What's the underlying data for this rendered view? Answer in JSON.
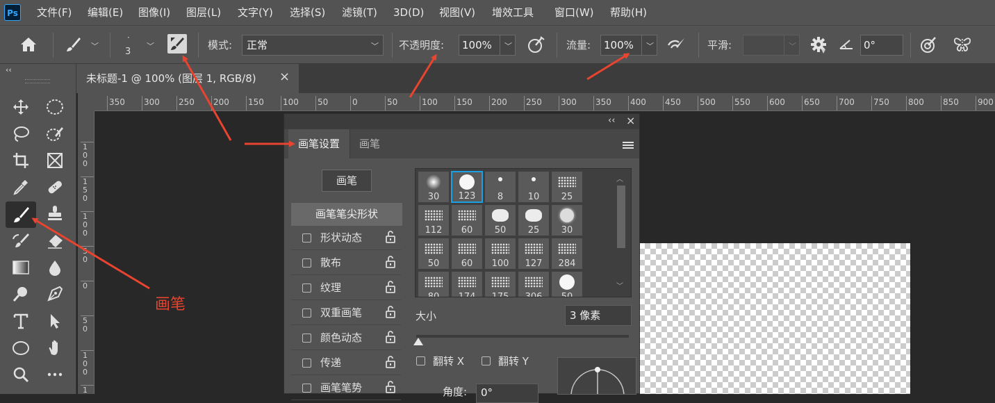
{
  "menubar": {
    "logo": "Ps",
    "items": [
      "文件(F)",
      "编辑(E)",
      "图像(I)",
      "图层(L)",
      "文字(Y)",
      "选择(S)",
      "滤镜(T)",
      "3D(D)",
      "视图(V)",
      "增效工具",
      "窗口(W)",
      "帮助(H)"
    ]
  },
  "options": {
    "brush_size": "3",
    "mode_label": "模式:",
    "mode_value": "正常",
    "opacity_label": "不透明度:",
    "opacity_value": "100%",
    "flow_label": "流量:",
    "flow_value": "100%",
    "smoothing_label": "平滑:",
    "smoothing_value": "",
    "angle_value": "0°"
  },
  "document": {
    "collapse": "‹‹",
    "tab_title": "未标题-1 @ 100% (图层 1, RGB/8)",
    "tab_close": "×"
  },
  "ruler": {
    "h_ticks": [
      "350",
      "300",
      "250",
      "200",
      "150",
      "100",
      "50",
      "0",
      "50",
      "100",
      "150",
      "200",
      "250",
      "300",
      "350",
      "400",
      "450",
      "500",
      "550",
      "600",
      "650",
      "700",
      "750",
      "800",
      "850",
      "900"
    ],
    "v_ticks": [
      [
        "1",
        "0",
        "0"
      ],
      [
        "1",
        "5",
        "0"
      ],
      [
        "1",
        "0",
        "0"
      ],
      [
        "5",
        "0"
      ],
      [
        "0"
      ],
      [
        "5",
        "0"
      ],
      [
        "1",
        "0",
        "0"
      ],
      [
        "1",
        "5",
        "0"
      ]
    ]
  },
  "brush_panel": {
    "collapse": "‹‹",
    "close": "×",
    "tab_settings": "画笔设置",
    "tab_brushes": "画笔",
    "brushes_button": "画笔",
    "tip_shape": "画笔笔尖形状",
    "options": [
      "形状动态",
      "散布",
      "纹理",
      "双重画笔",
      "颜色动态",
      "传递",
      "画笔笔势"
    ],
    "tips": [
      "30",
      "123",
      "8",
      "10",
      "25",
      "112",
      "60",
      "50",
      "25",
      "30",
      "50",
      "60",
      "100",
      "127",
      "284",
      "80",
      "174",
      "175",
      "306",
      "50"
    ],
    "size_label": "大小",
    "size_value": "3 像素",
    "size_fraction": 0.01,
    "flip_x": "翻转 X",
    "flip_y": "翻转 Y",
    "angle_label": "角度:",
    "angle_value": "0°"
  },
  "annotation": {
    "brush_label": "画笔",
    "color": "#e8442f"
  }
}
